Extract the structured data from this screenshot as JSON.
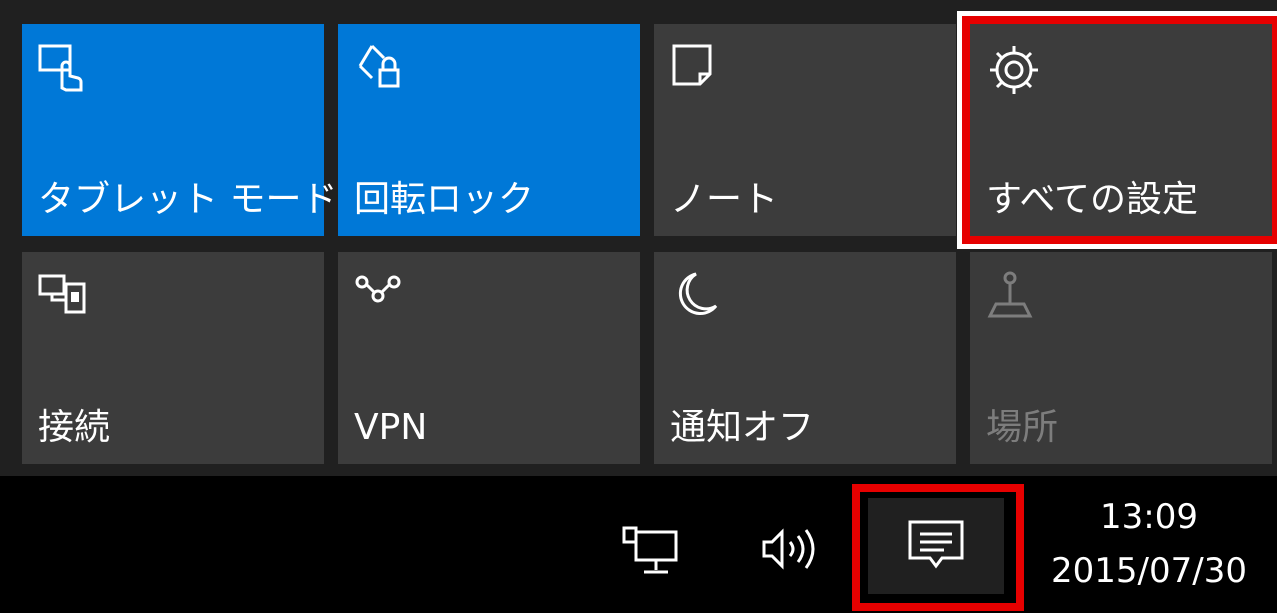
{
  "action_center": {
    "tiles": [
      {
        "label": "タブレット モード",
        "icon": "tablet-mode-icon",
        "state": "on"
      },
      {
        "label": "回転ロック",
        "icon": "rotation-lock-icon",
        "state": "on"
      },
      {
        "label": "ノート",
        "icon": "note-icon",
        "state": "off"
      },
      {
        "label": "すべての設定",
        "icon": "gear-icon",
        "state": "off"
      },
      {
        "label": "接続",
        "icon": "connect-icon",
        "state": "off"
      },
      {
        "label": "VPN",
        "icon": "vpn-icon",
        "state": "off"
      },
      {
        "label": "通知オフ",
        "icon": "moon-icon",
        "state": "off"
      },
      {
        "label": "場所",
        "icon": "location-icon",
        "state": "disabled"
      }
    ]
  },
  "taskbar": {
    "icons": [
      "network-icon",
      "volume-icon",
      "action-center-icon"
    ],
    "time": "13:09",
    "date": "2015/07/30"
  },
  "colors": {
    "accent": "#0078d7",
    "tile_off": "#3c3c3c",
    "highlight": "#e60000"
  }
}
